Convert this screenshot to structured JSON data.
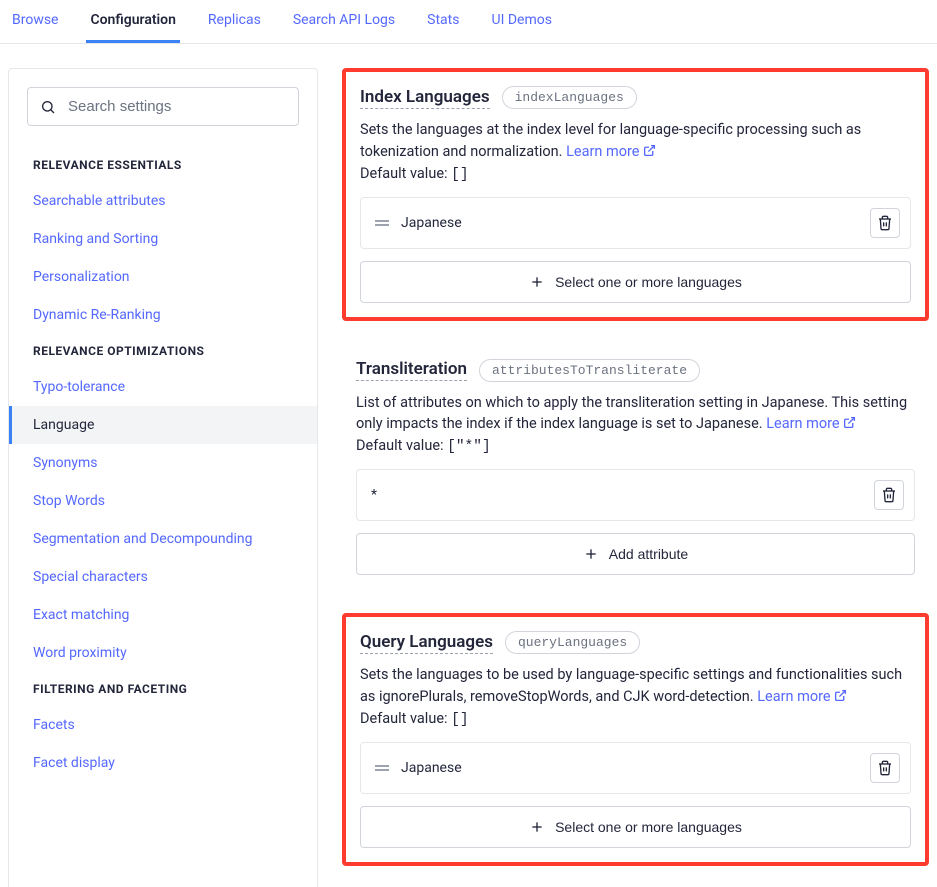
{
  "tabs": [
    {
      "label": "Browse"
    },
    {
      "label": "Configuration",
      "active": true
    },
    {
      "label": "Replicas"
    },
    {
      "label": "Search API Logs"
    },
    {
      "label": "Stats"
    },
    {
      "label": "UI Demos"
    }
  ],
  "search": {
    "placeholder": "Search settings"
  },
  "sidebar": {
    "sections": [
      {
        "title": "RELEVANCE ESSENTIALS",
        "items": [
          {
            "label": "Searchable attributes"
          },
          {
            "label": "Ranking and Sorting"
          },
          {
            "label": "Personalization"
          },
          {
            "label": "Dynamic Re-Ranking"
          }
        ]
      },
      {
        "title": "RELEVANCE OPTIMIZATIONS",
        "items": [
          {
            "label": "Typo-tolerance"
          },
          {
            "label": "Language",
            "active": true
          },
          {
            "label": "Synonyms"
          },
          {
            "label": "Stop Words"
          },
          {
            "label": "Segmentation and Decompounding"
          },
          {
            "label": "Special characters"
          },
          {
            "label": "Exact matching"
          },
          {
            "label": "Word proximity"
          }
        ]
      },
      {
        "title": "FILTERING AND FACETING",
        "items": [
          {
            "label": "Facets"
          },
          {
            "label": "Facet display"
          }
        ]
      }
    ]
  },
  "settings": {
    "indexLanguages": {
      "title": "Index Languages",
      "code": "indexLanguages",
      "description": "Sets the languages at the index level for language-specific processing such as tokenization and normalization.",
      "learn_more": "Learn more",
      "default_label": "Default value:",
      "default_value": "[]",
      "values": [
        {
          "label": "Japanese"
        }
      ],
      "add_label": "Select one or more languages"
    },
    "transliteration": {
      "title": "Transliteration",
      "code": "attributesToTransliterate",
      "description": "List of attributes on which to apply the transliteration setting in Japanese. This setting only impacts the index if the index language is set to Japanese.",
      "learn_more": "Learn more",
      "default_label": "Default value:",
      "default_value": "[\"*\"]",
      "values": [
        {
          "label": "*"
        }
      ],
      "add_label": "Add attribute"
    },
    "queryLanguages": {
      "title": "Query Languages",
      "code": "queryLanguages",
      "description": "Sets the languages to be used by language-specific settings and functionalities such as ignorePlurals, removeStopWords, and CJK word-detection.",
      "learn_more": "Learn more",
      "default_label": "Default value:",
      "default_value": "[]",
      "values": [
        {
          "label": "Japanese"
        }
      ],
      "add_label": "Select one or more languages"
    }
  }
}
